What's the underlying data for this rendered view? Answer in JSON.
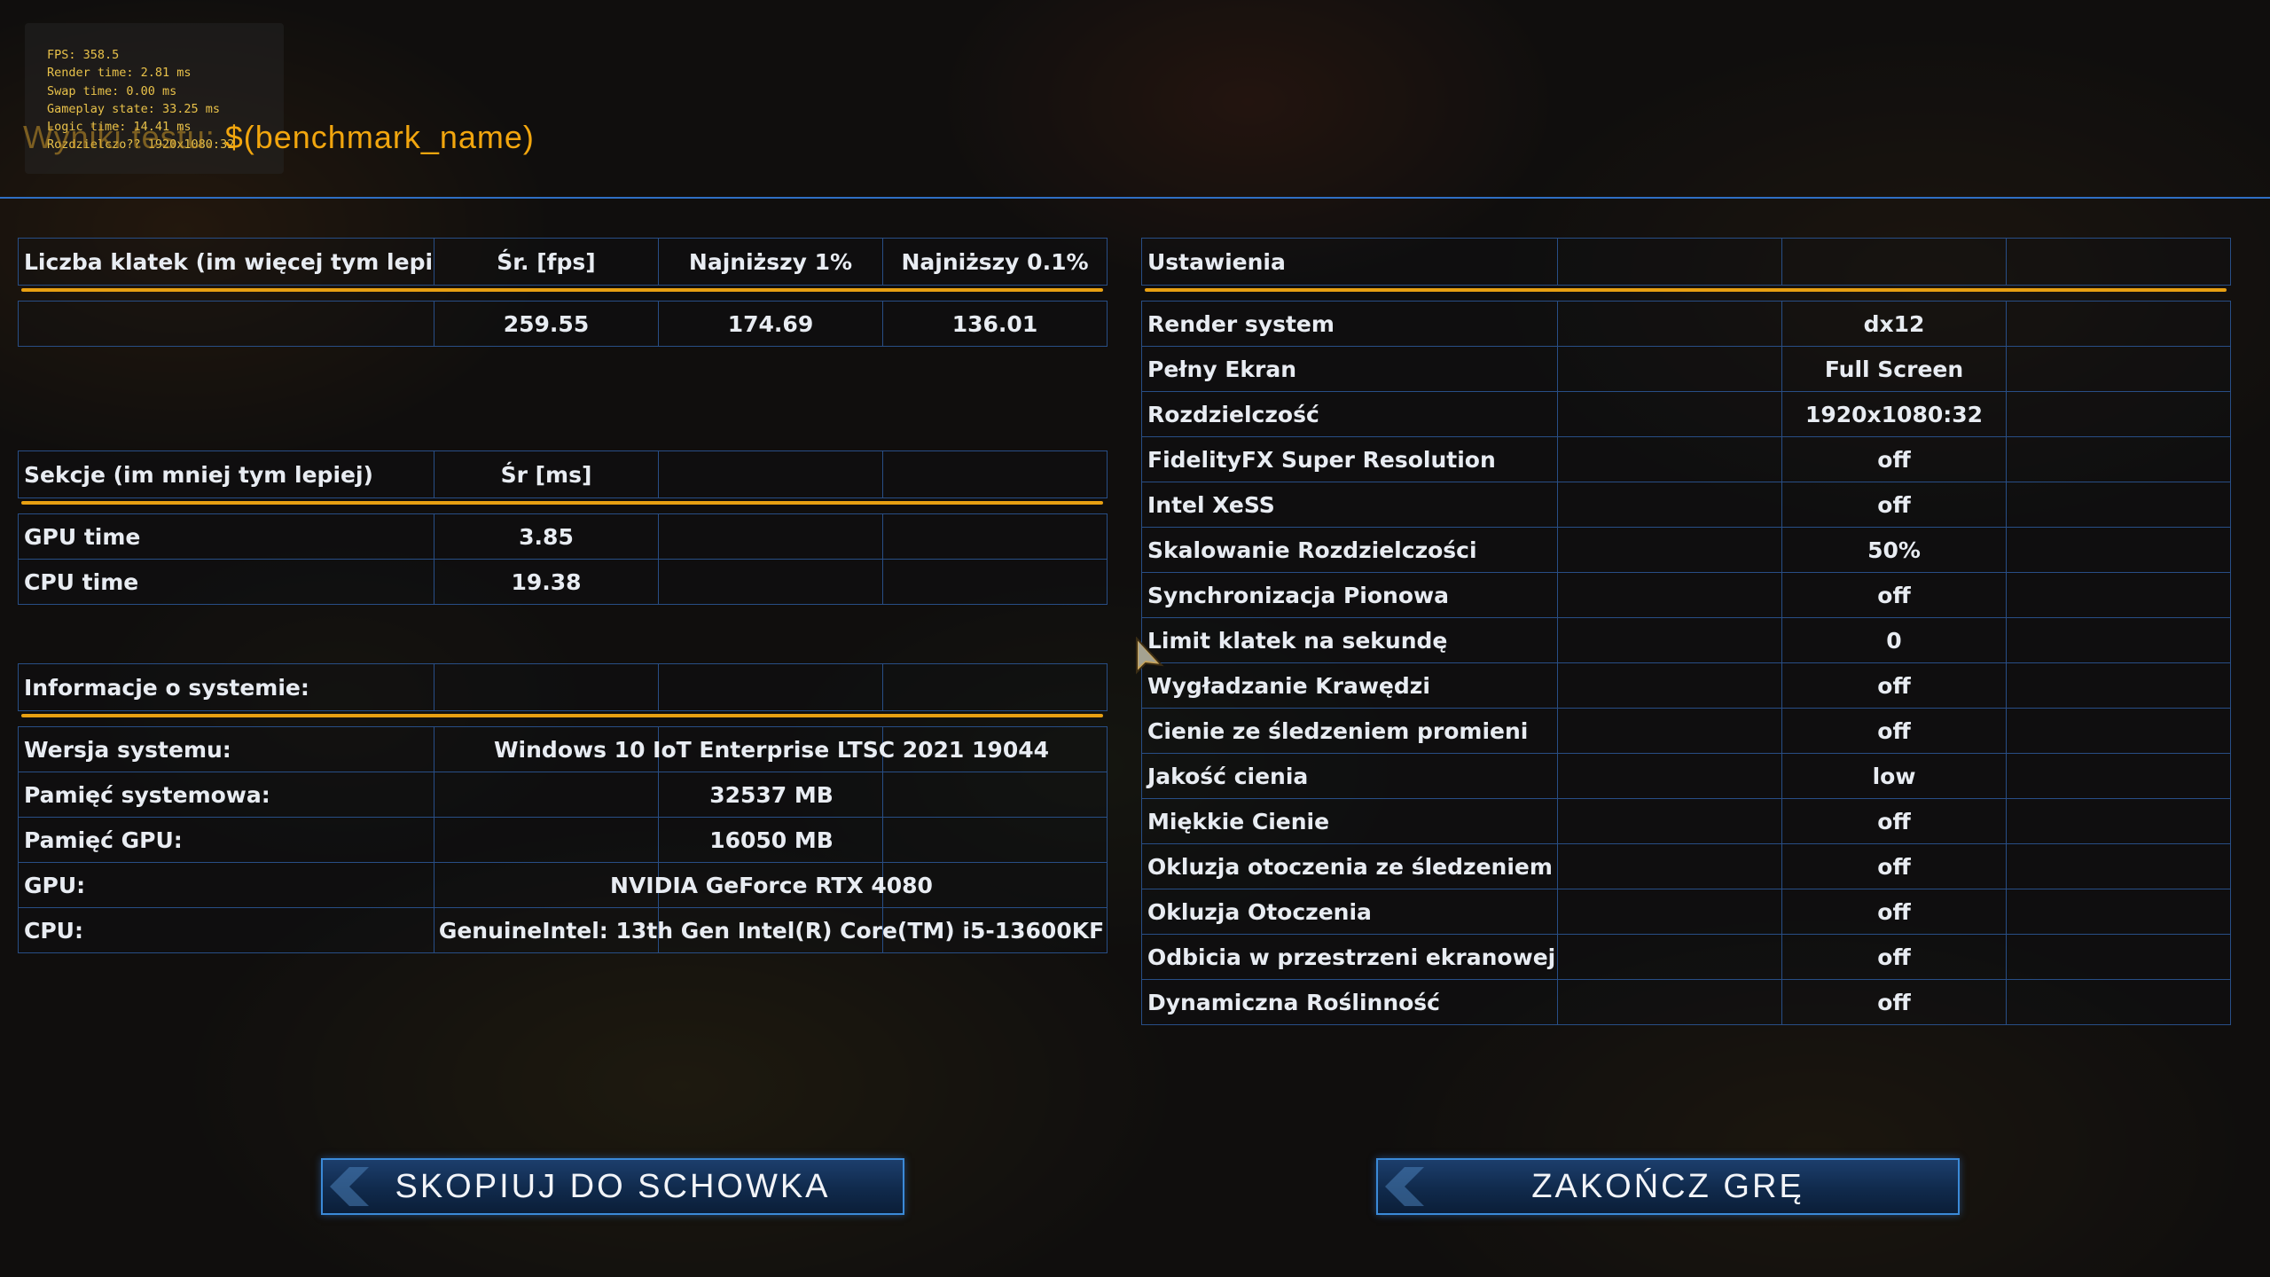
{
  "overlay_lines": [
    "FPS: 358.5",
    "Render time: 2.81 ms",
    "Swap time: 0.00 ms",
    "Gameplay state: 33.25 ms",
    "Logic time: 14.41 ms",
    "Rozdzielczo?? 1920x1080:32"
  ],
  "title": {
    "prefix": "Wyniki testu: ",
    "name": "$(benchmark_name)"
  },
  "fps_table": {
    "headers": [
      "Liczba klatek (im więcej tym lepiej)",
      "Śr. [fps]",
      "Najniższy 1%",
      "Najniższy 0.1%"
    ],
    "row": [
      "",
      "259.55",
      "174.69",
      "136.01"
    ]
  },
  "sections_table": {
    "headers": [
      "Sekcje (im mniej tym lepiej)",
      "Śr [ms]",
      "",
      ""
    ],
    "rows": [
      [
        "GPU time",
        "3.85"
      ],
      [
        "CPU time",
        "19.38"
      ]
    ]
  },
  "system_table": {
    "header": "Informacje o systemie:",
    "rows": [
      [
        "Wersja systemu:",
        "Windows 10 IoT Enterprise LTSC 2021 19044"
      ],
      [
        "Pamięć systemowa:",
        "32537 MB"
      ],
      [
        "Pamięć GPU:",
        "16050 MB"
      ],
      [
        "GPU:",
        "NVIDIA GeForce RTX 4080"
      ],
      [
        "CPU:",
        "GenuineIntel: 13th Gen Intel(R) Core(TM) i5-13600KF"
      ]
    ]
  },
  "settings_table": {
    "header": "Ustawienia",
    "rows": [
      [
        "Render system",
        "dx12"
      ],
      [
        "Pełny Ekran",
        "Full Screen"
      ],
      [
        "Rozdzielczość",
        "1920x1080:32"
      ],
      [
        "FidelityFX Super Resolution",
        "off"
      ],
      [
        "Intel XeSS",
        "off"
      ],
      [
        "Skalowanie Rozdzielczości",
        "50%"
      ],
      [
        "Synchronizacja Pionowa",
        "off"
      ],
      [
        "Limit klatek na sekundę",
        "0"
      ],
      [
        "Wygładzanie Krawędzi",
        "off"
      ],
      [
        "Cienie ze śledzeniem promieni",
        "off"
      ],
      [
        "Jakość cienia",
        "low"
      ],
      [
        "Miękkie Cienie",
        "off"
      ],
      [
        "Okluzja otoczenia ze śledzeniem promieni",
        "off"
      ],
      [
        "Okluzja Otoczenia",
        "off"
      ],
      [
        "Odbicia w przestrzeni ekranowej",
        "off"
      ],
      [
        "Dynamiczna Roślinność",
        "off"
      ]
    ]
  },
  "buttons": {
    "copy": "SKOPIUJ DO SCHOWKA",
    "quit": "ZAKOŃCZ GRĘ"
  },
  "colors": {
    "accent": "#e8a012",
    "border": "#284e86",
    "title": "#f2a60e",
    "overlay_text": "#e9c24a"
  }
}
